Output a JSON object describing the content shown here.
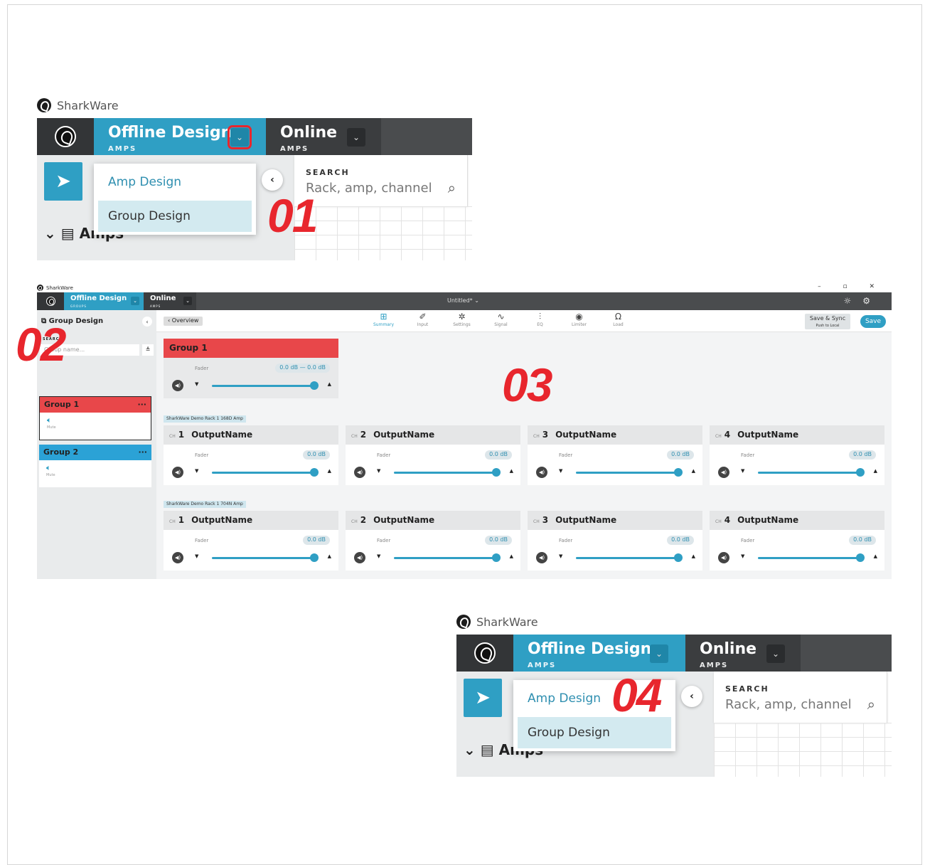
{
  "brand": "SharkWare",
  "annotations": [
    "01",
    "02",
    "03",
    "04"
  ],
  "zoom_panel": {
    "tab_offline": {
      "title": "Offline Design",
      "sub": "AMPS"
    },
    "tab_online": {
      "title": "Online",
      "sub": "AMPS"
    },
    "menu": [
      "Amp Design",
      "Group Design"
    ],
    "search_label": "SEARCH",
    "search_placeholder": "Rack, amp, channel",
    "amps_label": "Amps",
    "back_glyph": "‹",
    "chevron": "⌄"
  },
  "app": {
    "window_controls": "– ▫ ✕",
    "tab_offline": {
      "title": "Offline Design",
      "sub": "GROUPS"
    },
    "tab_online": {
      "title": "Online",
      "sub": "AMPS"
    },
    "doc_title": "Untitled* ⌄",
    "sidebar": {
      "title": "Group Design",
      "search_label": "SEARCH",
      "search_placeholder": "Group name...",
      "groups": [
        {
          "name": "Group 1",
          "mute": "Mute",
          "color": "#e8474a"
        },
        {
          "name": "Group 2",
          "mute": "Mute",
          "color": "#2ba2d6"
        }
      ]
    },
    "overview": "‹ Overview",
    "tabs": [
      {
        "label": "Summary",
        "icon": "⊞"
      },
      {
        "label": "Input",
        "icon": "✐"
      },
      {
        "label": "Settings",
        "icon": "✲"
      },
      {
        "label": "Signal",
        "icon": "∿"
      },
      {
        "label": "EQ",
        "icon": "⫶"
      },
      {
        "label": "Limiter",
        "icon": "◉"
      },
      {
        "label": "Load",
        "icon": "Ω"
      }
    ],
    "save_sync": "Save & Sync",
    "save_sync_sub": "Push to Local",
    "save": "Save",
    "group_fader": {
      "name": "Group 1",
      "fader_label": "Fader",
      "value": "0.0 dB — 0.0 dB",
      "level": 0.92
    },
    "racks": [
      {
        "label": "SharkWare Demo Rack 1    168D Amp",
        "channels": [
          {
            "ch": "CH",
            "num": "1",
            "name": "OutputName",
            "fader": "Fader",
            "value": "0.0 dB",
            "level": 0.92
          },
          {
            "ch": "CH",
            "num": "2",
            "name": "OutputName",
            "fader": "Fader",
            "value": "0.0 dB",
            "level": 0.92
          },
          {
            "ch": "CH",
            "num": "3",
            "name": "OutputName",
            "fader": "Fader",
            "value": "0.0 dB",
            "level": 0.92
          },
          {
            "ch": "CH",
            "num": "4",
            "name": "OutputName",
            "fader": "Fader",
            "value": "0.0 dB",
            "level": 0.92
          }
        ]
      },
      {
        "label": "SharkWare Demo Rack 1    704N Amp",
        "channels": [
          {
            "ch": "CH",
            "num": "1",
            "name": "OutputName",
            "fader": "Fader",
            "value": "0.0 dB",
            "level": 0.92
          },
          {
            "ch": "CH",
            "num": "2",
            "name": "OutputName",
            "fader": "Fader",
            "value": "0.0 dB",
            "level": 0.92
          },
          {
            "ch": "CH",
            "num": "3",
            "name": "OutputName",
            "fader": "Fader",
            "value": "0.0 dB",
            "level": 0.92
          },
          {
            "ch": "CH",
            "num": "4",
            "name": "OutputName",
            "fader": "Fader",
            "value": "0.0 dB",
            "level": 0.92
          }
        ]
      }
    ]
  }
}
